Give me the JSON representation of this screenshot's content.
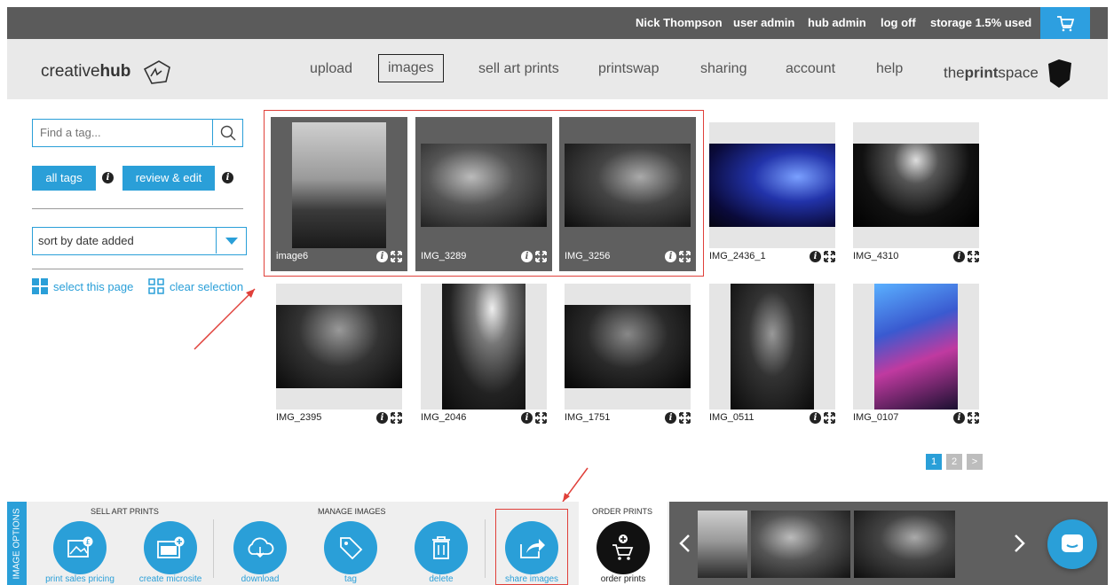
{
  "topbar": {
    "user": "Nick Thompson",
    "user_admin": "user admin",
    "hub_admin": "hub admin",
    "logoff": "log off",
    "storage": "storage 1.5% used",
    "cart_icon": "cart-icon"
  },
  "logo": {
    "text_light": "creative",
    "text_bold": "hub"
  },
  "nav": {
    "items": [
      "upload",
      "images",
      "sell art prints",
      "printswap",
      "sharing",
      "account",
      "help"
    ],
    "active": "images"
  },
  "brand": {
    "prefix": "the",
    "bold": "print",
    "suffix": "space"
  },
  "sidebar": {
    "search_placeholder": "Find a tag...",
    "all_tags": "all tags",
    "review_edit": "review & edit",
    "sort": "sort by date added",
    "select_page": "select this page",
    "clear_selection": "clear selection"
  },
  "images": [
    {
      "name": "image6",
      "selected": true
    },
    {
      "name": "IMG_3289",
      "selected": true
    },
    {
      "name": "IMG_3256",
      "selected": true
    },
    {
      "name": "IMG_2436_1",
      "selected": false
    },
    {
      "name": "IMG_4310",
      "selected": false
    },
    {
      "name": "IMG_2395",
      "selected": false
    },
    {
      "name": "IMG_2046",
      "selected": false
    },
    {
      "name": "IMG_1751",
      "selected": false
    },
    {
      "name": "IMG_0511",
      "selected": false
    },
    {
      "name": "IMG_0107",
      "selected": false
    }
  ],
  "pager": [
    "1",
    "2",
    ">"
  ],
  "bottom": {
    "side_label": "IMAGE OPTIONS",
    "groups": {
      "sell": "SELL ART PRINTS",
      "manage": "MANAGE IMAGES",
      "order": "ORDER PRINTS"
    },
    "actions": [
      "print sales pricing",
      "create microsite",
      "download",
      "tag",
      "delete",
      "share images"
    ],
    "order_label": "order prints"
  },
  "colors": {
    "accent": "#2a9fd8",
    "dark": "#5b5b5b",
    "highlight": "#e0403a"
  }
}
